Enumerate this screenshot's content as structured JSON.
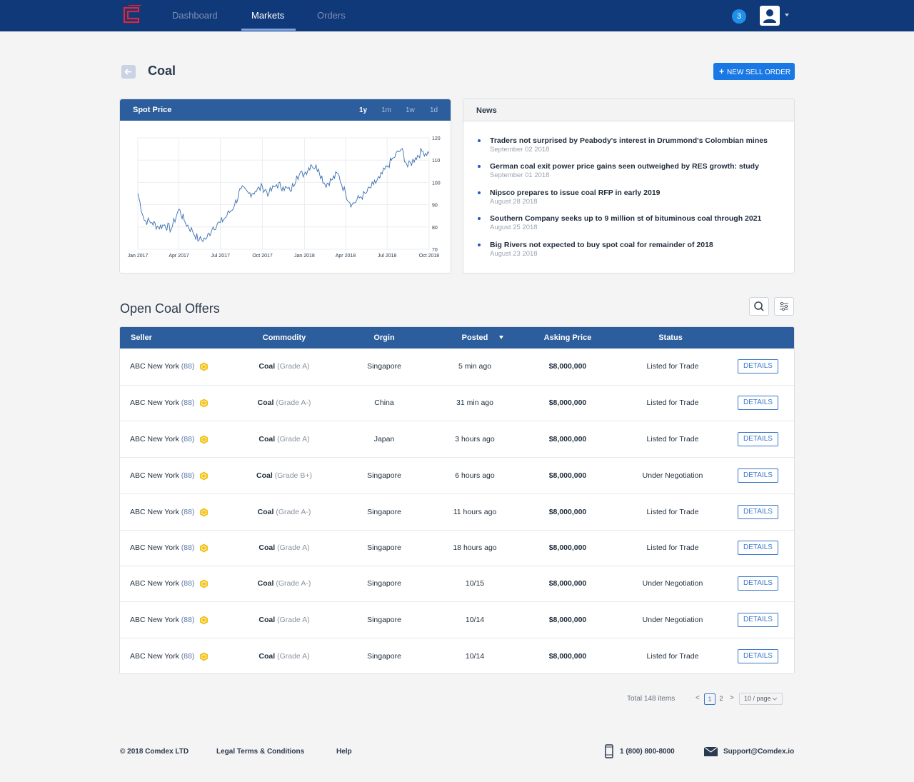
{
  "nav": {
    "items": [
      {
        "label": "Dashboard",
        "active": false
      },
      {
        "label": "Markets",
        "active": true
      },
      {
        "label": "Orders",
        "active": false
      }
    ],
    "notification_count": "3",
    "brand_color": "#10397a",
    "logo_color": "#e0253a"
  },
  "header": {
    "title": "Coal",
    "new_order_label": "NEW SELL ORDER",
    "back_icon": "arrow-left-icon"
  },
  "spot_price": {
    "title": "Spot Price",
    "ranges": [
      "1y",
      "1m",
      "1w",
      "1d"
    ],
    "selected_range": "1y"
  },
  "chart_data": {
    "type": "line",
    "title": "",
    "xlabel": "",
    "ylabel": "",
    "x_ticks": [
      "Jan 2017",
      "Apr 2017",
      "Jul 2017",
      "Oct 2017",
      "Jan 2018",
      "Apr 2018",
      "Jul 2018",
      "Oct 2018"
    ],
    "y_ticks": [
      120,
      110,
      100,
      90,
      80,
      70
    ],
    "ylim": [
      70,
      120
    ],
    "xlim": [
      "2017-01",
      "2018-10"
    ],
    "grid": true,
    "series": [
      {
        "color": "#3a6fb0",
        "x": [
          "2017-01-01",
          "2017-01-15",
          "2017-02-01",
          "2017-02-15",
          "2017-03-01",
          "2017-03-15",
          "2017-04-01",
          "2017-04-15",
          "2017-05-01",
          "2017-05-15",
          "2017-06-01",
          "2017-06-15",
          "2017-07-01",
          "2017-07-15",
          "2017-08-01",
          "2017-08-15",
          "2017-09-01",
          "2017-09-15",
          "2017-10-01",
          "2017-10-15",
          "2017-11-01",
          "2017-11-15",
          "2017-12-01",
          "2017-12-15",
          "2018-01-01",
          "2018-01-15",
          "2018-02-01",
          "2018-02-15",
          "2018-03-01",
          "2018-03-15",
          "2018-04-01",
          "2018-04-15",
          "2018-05-01",
          "2018-05-15",
          "2018-06-01",
          "2018-06-15",
          "2018-07-01",
          "2018-07-15",
          "2018-08-01",
          "2018-08-15",
          "2018-09-01",
          "2018-09-15",
          "2018-10-01"
        ],
        "y": [
          95,
          83,
          82,
          80,
          81,
          79,
          88,
          82,
          78,
          74,
          75,
          80,
          82,
          85,
          90,
          97,
          95,
          96,
          98,
          95,
          99,
          98,
          96,
          103,
          104,
          108,
          106,
          99,
          101,
          104,
          95,
          90,
          93,
          95,
          99,
          102,
          107,
          111,
          115,
          107,
          111,
          114,
          113
        ]
      }
    ]
  },
  "news": {
    "title": "News",
    "items": [
      {
        "headline": "Traders not surprised by Peabody's interest in Drummond's Colombian mines",
        "date": "September 02 2018"
      },
      {
        "headline": "German coal exit power price gains seen outweighed by RES growth: study",
        "date": "September 01 2018"
      },
      {
        "headline": "Nipsco prepares to issue coal RFP in early 2019",
        "date": "August 28 2018"
      },
      {
        "headline": "Southern Company seeks up to 9 million st of bituminous coal through 2021",
        "date": "August 25 2018"
      },
      {
        "headline": "Big Rivers not expected to buy spot coal for remainder of 2018",
        "date": "August 23 2018"
      }
    ]
  },
  "offers": {
    "title": "Open Coal Offers",
    "search_icon": "search-icon",
    "filter_icon": "sliders-icon",
    "columns": [
      "Seller",
      "Commodity",
      "Orgin",
      "Posted",
      "Asking Price",
      "Status"
    ],
    "details_label": "DETAILS",
    "rows": [
      {
        "seller": "ABC New York",
        "rating": "(88)",
        "commodity": "Coal",
        "grade": "(Grade A)",
        "origin": "Singapore",
        "posted": "5 min ago",
        "price": "$8,000,000",
        "status": "Listed for Trade"
      },
      {
        "seller": "ABC New York",
        "rating": "(88)",
        "commodity": "Coal",
        "grade": "(Grade A-)",
        "origin": "China",
        "posted": "31 min ago",
        "price": "$8,000,000",
        "status": "Listed for Trade"
      },
      {
        "seller": "ABC New York",
        "rating": "(88)",
        "commodity": "Coal",
        "grade": "(Grade A)",
        "origin": "Japan",
        "posted": "3 hours ago",
        "price": "$8,000,000",
        "status": "Listed for Trade"
      },
      {
        "seller": "ABC New York",
        "rating": "(88)",
        "commodity": "Coal",
        "grade": "(Grade B+)",
        "origin": "Singapore",
        "posted": "6 hours ago",
        "price": "$8,000,000",
        "status": "Under Negotiation"
      },
      {
        "seller": "ABC New York",
        "rating": "(88)",
        "commodity": "Coal",
        "grade": "(Grade A-)",
        "origin": "Singapore",
        "posted": "11 hours ago",
        "price": "$8,000,000",
        "status": "Listed for Trade"
      },
      {
        "seller": "ABC New York",
        "rating": "(88)",
        "commodity": "Coal",
        "grade": "(Grade A)",
        "origin": "Singapore",
        "posted": "18 hours ago",
        "price": "$8,000,000",
        "status": "Listed for Trade"
      },
      {
        "seller": "ABC New York",
        "rating": "(88)",
        "commodity": "Coal",
        "grade": "(Grade A-)",
        "origin": "Singapore",
        "posted": "10/15",
        "price": "$8,000,000",
        "status": "Under Negotiation"
      },
      {
        "seller": "ABC New York",
        "rating": "(88)",
        "commodity": "Coal",
        "grade": "(Grade A)",
        "origin": "Singapore",
        "posted": "10/14",
        "price": "$8,000,000",
        "status": "Under Negotiation"
      },
      {
        "seller": "ABC New York",
        "rating": "(88)",
        "commodity": "Coal",
        "grade": "(Grade A)",
        "origin": "Singapore",
        "posted": "10/14",
        "price": "$8,000,000",
        "status": "Listed for Trade"
      }
    ]
  },
  "pagination": {
    "total": "Total 148 items",
    "prev": "<",
    "next": ">",
    "pages": [
      "1",
      "2"
    ],
    "current": "1",
    "page_size": "10 / page"
  },
  "footer": {
    "copyright": "© 2018 Comdex LTD",
    "legal": "Legal Terms & Conditions",
    "help": "Help",
    "phone": "1 (800) 800-8000",
    "email": "Support@Comdex.io"
  }
}
